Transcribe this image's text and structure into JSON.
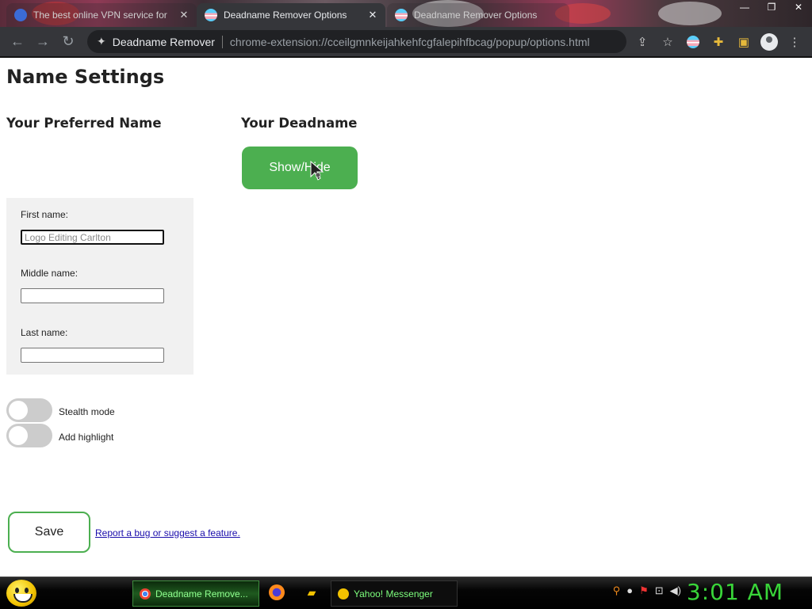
{
  "browser": {
    "tabs": [
      {
        "title": "The best online VPN service for",
        "active": false
      },
      {
        "title": "Deadname Remover Options",
        "active": true
      },
      {
        "title": "Deadname Remover Options",
        "active": false
      }
    ],
    "omnibox": {
      "site_name": "Deadname Remover",
      "url": "chrome-extension://cceilgmnkeijahkehfcgfalepihfbcag/popup/options.html"
    }
  },
  "page": {
    "title": "Name Settings",
    "preferred_heading": "Your Preferred Name",
    "deadname_heading": "Your Deadname",
    "show_hide_label": "Show/Hide",
    "fields": {
      "first_label": "First name:",
      "first_placeholder": "Logo Editing Carlton",
      "middle_label": "Middle name:",
      "last_label": "Last name:"
    },
    "toggles": {
      "stealth_label": "Stealth mode",
      "stealth_on": false,
      "highlight_label": "Add highlight",
      "highlight_on": false
    },
    "save_label": "Save",
    "report_link": "Report a bug or suggest a feature."
  },
  "taskbar": {
    "tasks": [
      {
        "label": "Deadname Remove...",
        "active": true
      },
      {
        "label": "Yahoo! Messenger",
        "active": false
      }
    ],
    "clock": "3:01 AM"
  },
  "colors": {
    "accent_green": "#4caf50",
    "chrome_dark": "#35363a",
    "clock_green": "#39d539"
  }
}
